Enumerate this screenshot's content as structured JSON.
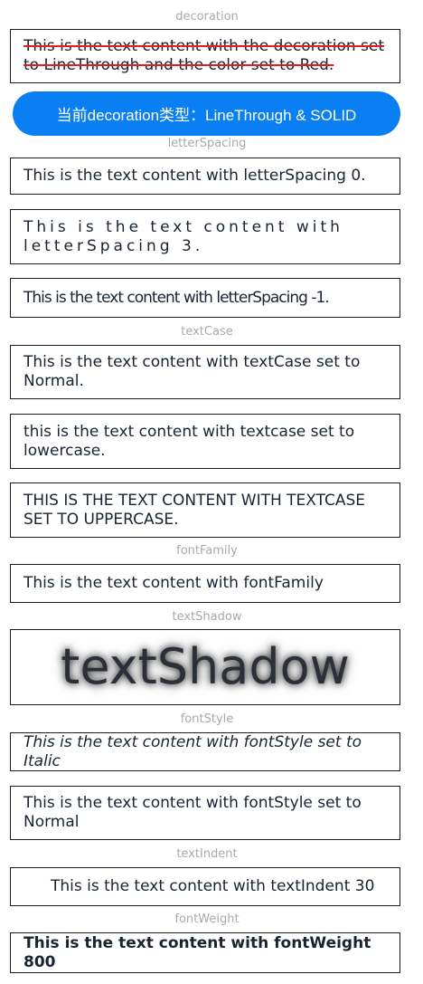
{
  "sections": {
    "decoration": "decoration",
    "letterSpacing": "letterSpacing",
    "textCase": "textCase",
    "fontFamily": "fontFamily",
    "textShadow": "textShadow",
    "fontStyle": "fontStyle",
    "textIndent": "textIndent",
    "fontWeight": "fontWeight"
  },
  "decoration": {
    "text": "This is the text content with the decoration set to LineThrough and the color set to Red.",
    "decoration_color": "#e02020",
    "button_label": "当前decoration类型：LineThrough & SOLID",
    "button_color": "#0a7ff4"
  },
  "letterSpacing": {
    "zero": "This is the text content with letterSpacing 0.",
    "three": "This is the text content with letterSpacing 3.",
    "minus_one": "This is the text content with letterSpacing -1."
  },
  "textCase": {
    "normal": "This is the text content with textCase set to Normal.",
    "lower": "this is the text content with textcase set to lowercase.",
    "upper": "THIS IS THE TEXT CONTENT WITH TEXTCASE SET TO UPPERCASE."
  },
  "fontFamily": {
    "text": "This is the text content with fontFamily"
  },
  "textShadow": {
    "text": "textShadow"
  },
  "fontStyle": {
    "italic": "This is the text content with fontStyle set to Italic",
    "normal": "This is the text content with fontStyle set to Normal"
  },
  "textIndent": {
    "text": "This is the text content with textIndent 30"
  },
  "fontWeight": {
    "text": "This is the text content with fontWeight 800"
  }
}
